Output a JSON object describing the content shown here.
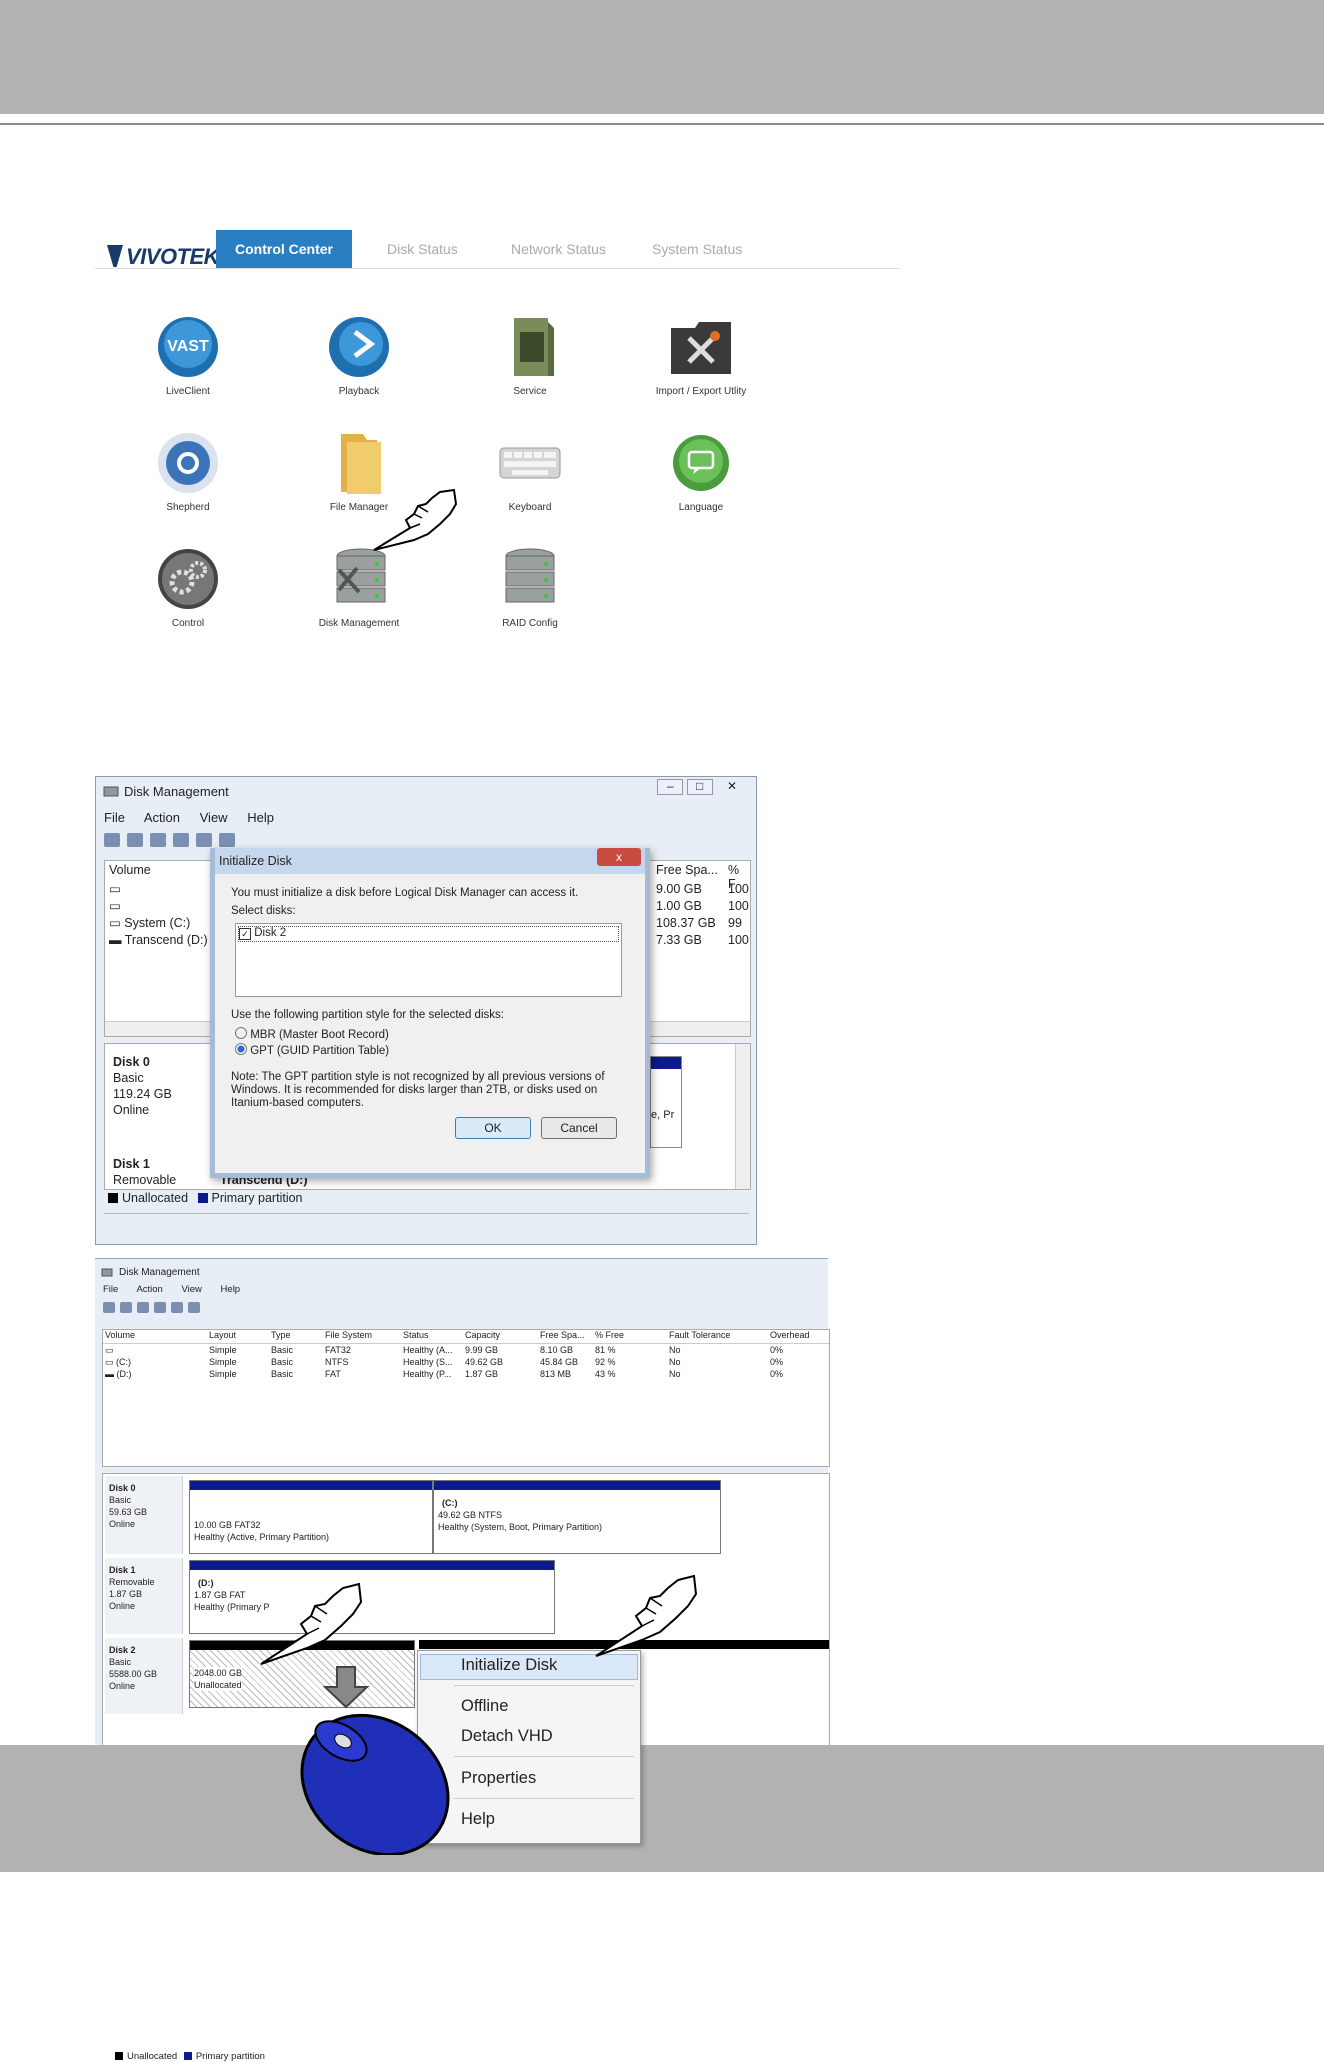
{
  "control_center": {
    "logo": "VIVOTEK",
    "tabs": [
      "Control Center",
      "Disk Status",
      "Network Status",
      "System Status"
    ],
    "items": [
      {
        "label": "LiveClient",
        "icon": "vast-liveclient-icon"
      },
      {
        "label": "Playback",
        "icon": "vast-playback-icon"
      },
      {
        "label": "Service",
        "icon": "service-icon"
      },
      {
        "label": "Import / Export Utlity",
        "icon": "import-export-icon"
      },
      {
        "label": "Shepherd",
        "icon": "shepherd-icon"
      },
      {
        "label": "File Manager",
        "icon": "folder-icon"
      },
      {
        "label": "Keyboard",
        "icon": "keyboard-icon"
      },
      {
        "label": "Language",
        "icon": "language-icon"
      },
      {
        "label": "Control",
        "icon": "gears-icon"
      },
      {
        "label": "Disk Management",
        "icon": "disk-management-icon"
      },
      {
        "label": "RAID Config",
        "icon": "raid-icon"
      }
    ]
  },
  "disk_mgmt_1": {
    "title": "Disk Management",
    "menu": [
      "File",
      "Action",
      "View",
      "Help"
    ],
    "volume_header": "Volume",
    "free_space_header": "Free Spa...",
    "percent_header": "% F",
    "volumes": [
      {
        "name": "",
        "free": "9.00 GB",
        "pct": "100"
      },
      {
        "name": "",
        "free": "1.00 GB",
        "pct": "100"
      },
      {
        "name": "System (C:)",
        "free": "108.37 GB",
        "pct": "99"
      },
      {
        "name": "Transcend (D:)",
        "free": "7.33 GB",
        "pct": "100"
      }
    ],
    "disk0": {
      "name": "Disk 0",
      "type": "Basic",
      "size": "119.24 GB",
      "status": "Online"
    },
    "disk1": {
      "name": "Disk 1",
      "type": "Removable",
      "partition": "Transcend (D:)"
    },
    "partial_text": "e, Pr",
    "legend": [
      "Unallocated",
      "Primary partition"
    ]
  },
  "dialog": {
    "title": "Initialize Disk",
    "close": "x",
    "intro": "You must initialize a disk before Logical Disk Manager can access it.",
    "select_label": "Select disks:",
    "disk_item": "Disk 2",
    "style_label": "Use the following partition style for the selected disks:",
    "mbr": "MBR (Master Boot Record)",
    "gpt": "GPT (GUID Partition Table)",
    "note1": "Note: The GPT partition style is not recognized by all previous versions of",
    "note2": "Windows. It is recommended for disks larger than 2TB, or disks used on",
    "note3": "Itanium-based computers.",
    "ok": "OK",
    "cancel": "Cancel"
  },
  "disk_mgmt_2": {
    "title": "Disk Management",
    "menu": [
      "File",
      "Action",
      "View",
      "Help"
    ],
    "headers": [
      "Volume",
      "Layout",
      "Type",
      "File System",
      "Status",
      "Capacity",
      "Free Spa...",
      "% Free",
      "Fault Tolerance",
      "Overhead"
    ],
    "rows": [
      [
        "",
        "Simple",
        "Basic",
        "FAT32",
        "Healthy (A...",
        "9.99 GB",
        "8.10 GB",
        "81 %",
        "No",
        "0%"
      ],
      [
        "(C:)",
        "Simple",
        "Basic",
        "NTFS",
        "Healthy (S...",
        "49.62 GB",
        "45.84 GB",
        "92 %",
        "No",
        "0%"
      ],
      [
        "(D:)",
        "Simple",
        "Basic",
        "FAT",
        "Healthy (P...",
        "1.87 GB",
        "813 MB",
        "43 %",
        "No",
        "0%"
      ]
    ],
    "disk0": {
      "name": "Disk 0",
      "type": "Basic",
      "size": "59.63 GB",
      "status": "Online",
      "p1": {
        "size": "10.00 GB FAT32",
        "health": "Healthy (Active, Primary Partition)"
      },
      "p2": {
        "letter": "(C:)",
        "size": "49.62 GB NTFS",
        "health": "Healthy (System, Boot, Primary Partition)"
      }
    },
    "disk1": {
      "name": "Disk 1",
      "type": "Removable",
      "size": "1.87 GB",
      "status": "Online",
      "p1": {
        "letter": "(D:)",
        "size": "1.87 GB FAT",
        "health": "Healthy (Primary P"
      }
    },
    "disk2": {
      "name": "Disk 2",
      "type": "Basic",
      "size": "5588.00 GB",
      "status": "Online",
      "p1": {
        "size": "2048.00 GB",
        "health": "Unallocated"
      }
    },
    "context_menu": [
      "Initialize Disk",
      "Offline",
      "Detach VHD",
      "Properties",
      "Help"
    ],
    "legend": [
      "Unallocated",
      "Primary partition"
    ]
  }
}
